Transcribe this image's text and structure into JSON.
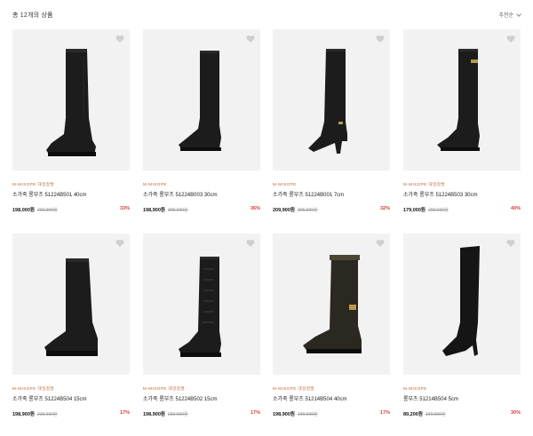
{
  "header": {
    "count_text": "총 12개의 상품",
    "sort_label": "추천순"
  },
  "products": [
    {
      "brand": "M-MISOPE 대일점발",
      "name": "소가죽 롱부츠 51224B501 40cm",
      "price": "198,000원",
      "original": "290,000원",
      "discount": "33%",
      "image": "tall-chunky-boot"
    },
    {
      "brand": "M-MISOPE",
      "name": "소가죽 롱부츠 51224B003 30cm",
      "price": "198,900원",
      "original": "309,000원",
      "discount": "36%",
      "image": "tall-boot"
    },
    {
      "brand": "M-MISOPE",
      "name": "소가죽 롱부츠 51224B001 7cm",
      "price": "209,900원",
      "original": "305,000원",
      "discount": "32%",
      "image": "heeled-buckle-boot"
    },
    {
      "brand": "M-MISOPE 대일점발",
      "name": "소가죽 롱부츠 51224B503 30cm",
      "price": "179,000원",
      "original": "299,000원",
      "discount": "40%",
      "image": "buckle-riding-boot"
    },
    {
      "brand": "M-MISOPE 대일점발",
      "name": "소가죽 롱부츠 51224B504 15cm",
      "price": "198,900원",
      "original": "239,000원",
      "discount": "17%",
      "image": "mid-boot"
    },
    {
      "brand": "M-MISOPE 대일점발",
      "name": "소가죽 롱부츠 51224B502 15cm",
      "price": "198,900원",
      "original": "239,000원",
      "discount": "17%",
      "image": "lace-up-boot"
    },
    {
      "brand": "M-MISOPE 대일점발",
      "name": "소가죽 롱부츠 51214B504 40cm",
      "price": "198,900원",
      "original": "239,000원",
      "discount": "17%",
      "image": "shearling-boot"
    },
    {
      "brand": "M-MISOPE",
      "name": "롱부츠 51214B504 5cm",
      "price": "89,200원",
      "original": "129,000원",
      "discount": "30%",
      "image": "over-knee-boot"
    }
  ],
  "colors": {
    "brand": "#c0602a",
    "discount": "#e23a3a",
    "tile": "#f2f2f2"
  }
}
